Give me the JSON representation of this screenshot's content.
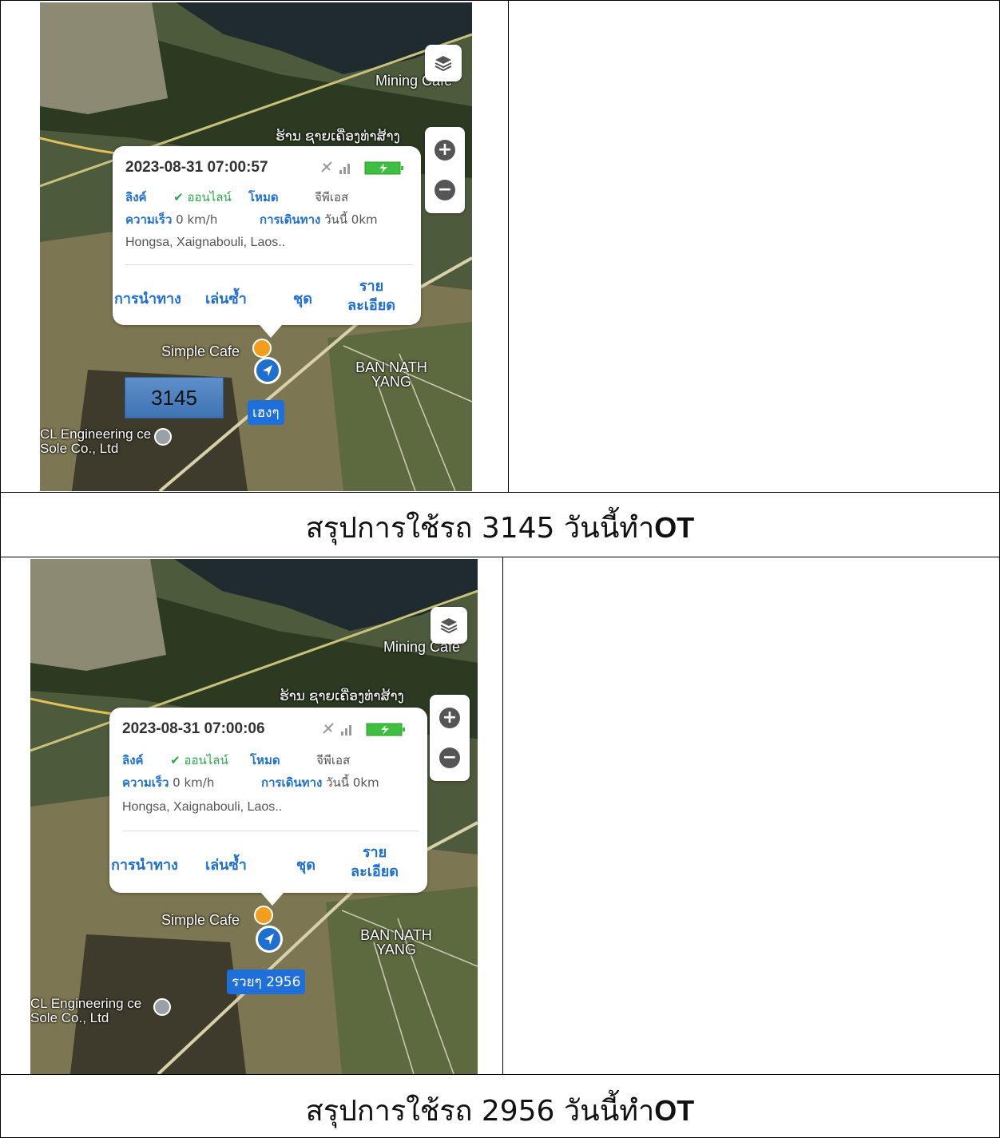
{
  "rows": [
    {
      "map": {
        "place_cafe_top": "Mining Cafe",
        "place_lao": "ຮ້ານ ຊາຍເຄື່ອງທ່າສ້າງ",
        "place_simple_cafe": "Simple Cafe",
        "place_village": "BAN NATH YANG",
        "place_engineering": "CL Engineering ce Sole Co., Ltd",
        "vehicle_label": "เฮงๆ",
        "overlay_number": "3145"
      },
      "popup": {
        "timestamp": "2023-08-31 07:00:57",
        "link_key": "ลิงค์",
        "link_status": "ออนไลน์",
        "mode_key": "โหมด",
        "mode_value": "จีพีเอส",
        "speed_key": "ความเร็ว",
        "speed_value": "0 km/h",
        "trip_key": "การเดินทาง",
        "trip_value": "วันนี้ 0km",
        "address": "Hongsa, Xaignabouli, Laos..",
        "actions": [
          "การนำทาง",
          "เล่นซ้ำ",
          "ชุด",
          "ราย ละเอียด"
        ]
      },
      "caption": {
        "text": "สรุปการใช้รถ 3145 วันนี้ทำ",
        "suffix": "OT"
      }
    },
    {
      "map": {
        "place_cafe_top": "Mining Cafe",
        "place_lao": "ຮ້ານ ຊາຍເຄື່ອງທ່າສ້າງ",
        "place_simple_cafe": "Simple Cafe",
        "place_village": "BAN NATH YANG",
        "place_engineering": "CL Engineering ce Sole Co., Ltd",
        "vehicle_label": "รวยๆ 2956"
      },
      "popup": {
        "timestamp": "2023-08-31 07:00:06",
        "link_key": "ลิงค์",
        "link_status": "ออนไลน์",
        "mode_key": "โหมด",
        "mode_value": "จีพีเอส",
        "speed_key": "ความเร็ว",
        "speed_value": "0 km/h",
        "trip_key": "การเดินทาง",
        "trip_value": "วันนี้ 0km",
        "address": "Hongsa, Xaignabouli, Laos..",
        "actions": [
          "การนำทาง",
          "เล่นซ้ำ",
          "ชุด",
          "ราย ละเอียด"
        ]
      },
      "caption": {
        "text": "สรุปการใช้รถ 2956 วันนี้ทำ",
        "suffix": "OT"
      }
    }
  ],
  "icons": {
    "layers": "layers-icon",
    "zoom_in": "zoom-in-icon",
    "zoom_out": "zoom-out-icon",
    "gps_off": "gps-off-icon",
    "signal": "signal-icon",
    "battery": "battery-charging-icon",
    "vehicle": "navigation-arrow-icon"
  },
  "colors": {
    "link": "#1f6fd1",
    "online": "#2aa84a",
    "battery": "#3fbf3f"
  }
}
